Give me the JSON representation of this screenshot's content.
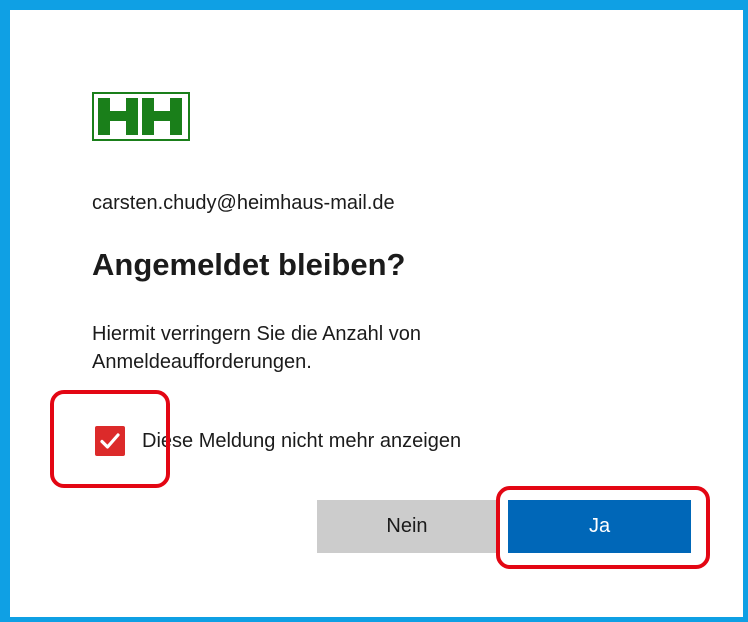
{
  "logo": {
    "text": "HH",
    "color": "#1a7f1a"
  },
  "account": {
    "email": "carsten.chudy@heimhaus-mail.de"
  },
  "dialog": {
    "title": "Angemeldet bleiben?",
    "description": "Hiermit verringern Sie die Anzahl von Anmeldeaufforderungen."
  },
  "checkbox": {
    "label": "Diese Meldung nicht mehr anzeigen",
    "checked": true,
    "color": "#dc2a2a"
  },
  "buttons": {
    "no_label": "Nein",
    "yes_label": "Ja",
    "yes_color": "#0067b8",
    "no_color": "#cccccc"
  },
  "annotations": {
    "color": "#e30613",
    "highlighted": [
      "checkbox",
      "yes-button"
    ]
  },
  "colors": {
    "frame_border": "#0fa0e4"
  }
}
